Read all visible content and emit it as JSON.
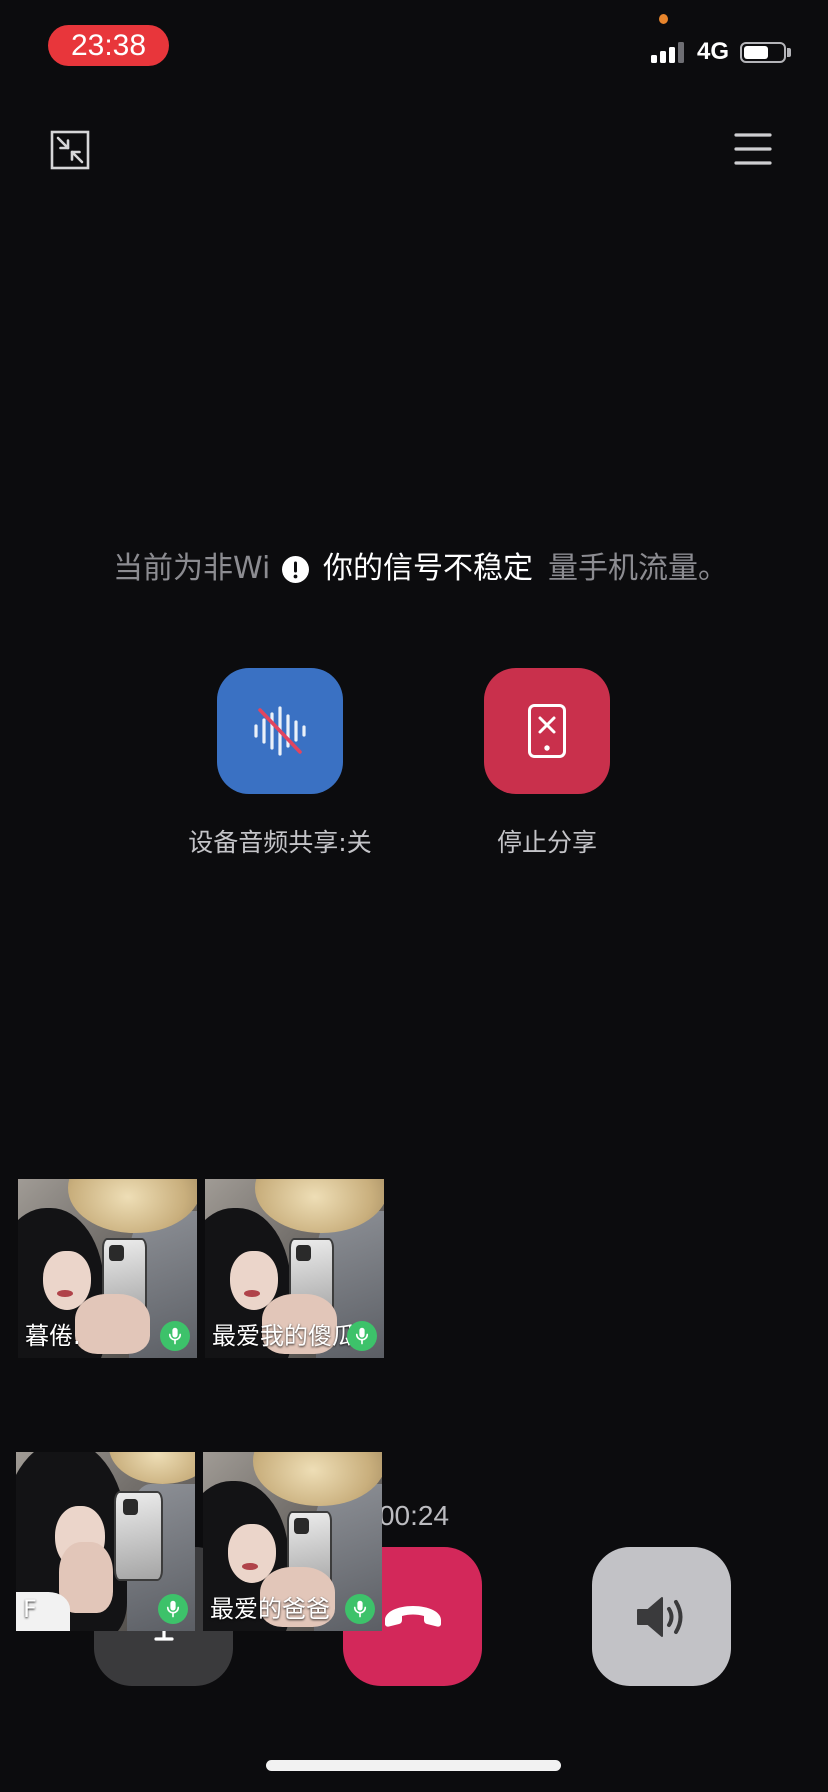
{
  "status_bar": {
    "time": "23:38",
    "network_type": "4G",
    "signal_bars": 3,
    "signal_max": 4,
    "battery_level": 0.62,
    "time_pill_color": "#e8363b",
    "indicator_dot_color": "#e8852c",
    "signal_icon": "cellular-signal-icon",
    "battery_icon": "battery-icon"
  },
  "top_bar": {
    "minimize_icon": "minimize-icon",
    "menu_icon": "menu-icon"
  },
  "network_notice": {
    "text_left": "当前为非Wi",
    "text_right": "量手机流量。"
  },
  "toast": {
    "icon": "exclamation-icon",
    "text": "你的信号不稳定"
  },
  "share_controls": {
    "audio_share": {
      "label": "设备音频共享:关",
      "icon": "audio-share-off-icon",
      "color": "#3a71c3"
    },
    "stop_share": {
      "label": "停止分享",
      "icon": "stop-share-phone-icon",
      "color": "#c9304c"
    }
  },
  "participants": [
    {
      "name": "暮倦.",
      "mic_icon": "mic-icon"
    },
    {
      "name": "最爱我的傻瓜",
      "mic_icon": "mic-icon"
    },
    {
      "name": "F",
      "mic_icon": "mic-icon"
    },
    {
      "name": "最爱的爸爸",
      "mic_icon": "mic-icon"
    }
  ],
  "participant_mic_color": "#3dc26a",
  "call": {
    "timer": "00:24",
    "mute_button": {
      "icon": "mic-icon",
      "color": "#3a3a3c"
    },
    "hang_up_button": {
      "icon": "hang-up-icon",
      "color": "#d3285a"
    },
    "speaker_button": {
      "icon": "speaker-icon",
      "color": "#c2c2c6"
    }
  }
}
